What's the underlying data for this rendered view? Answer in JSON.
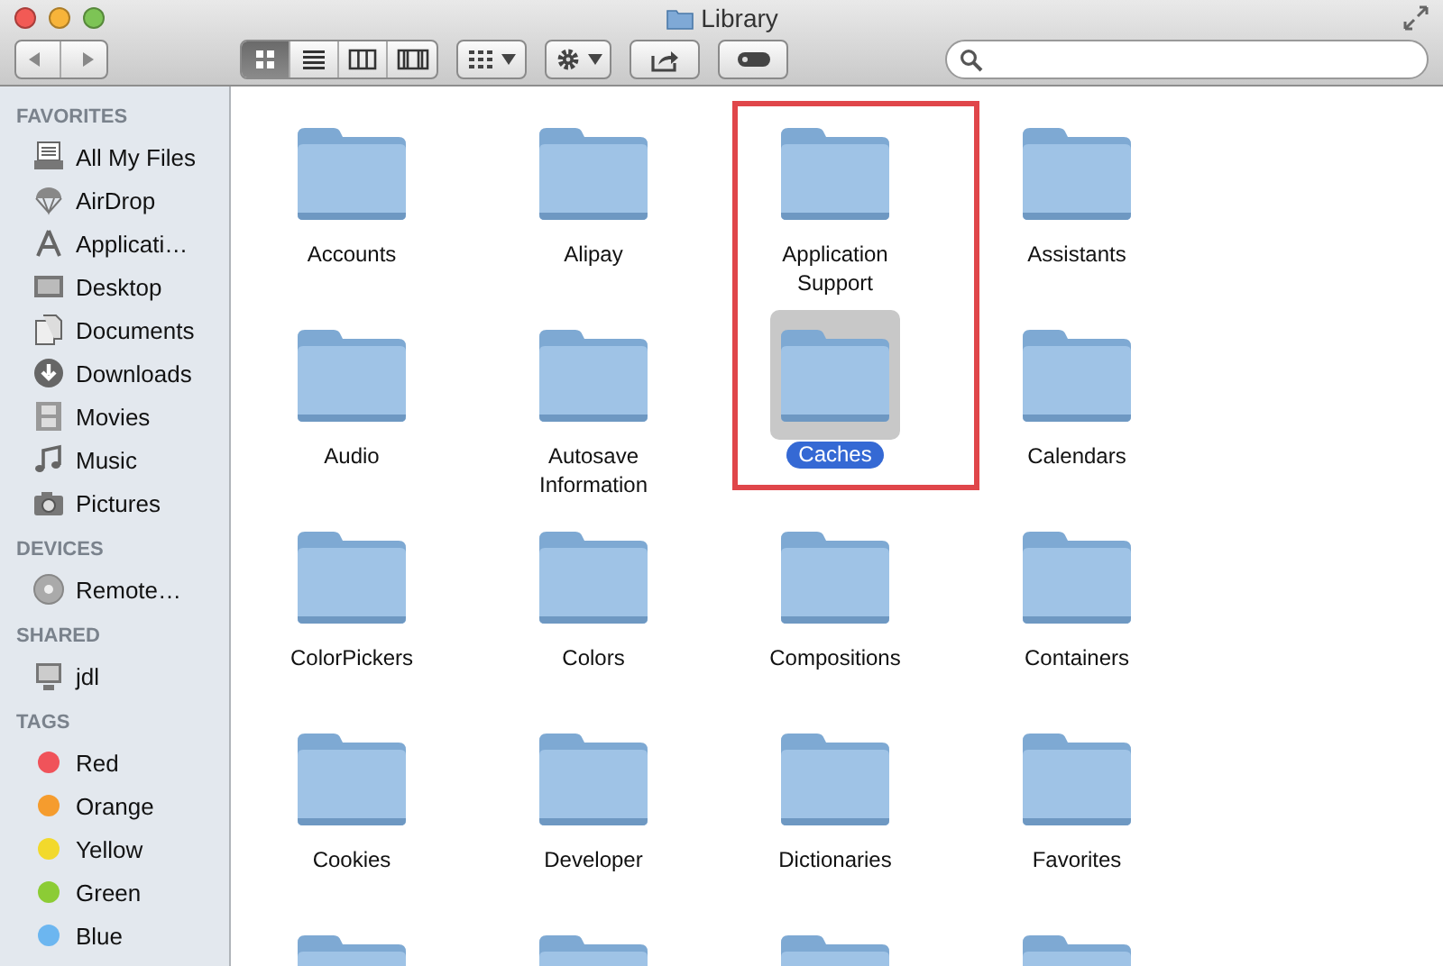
{
  "window": {
    "title": "Library"
  },
  "toolbar": {
    "view_modes": [
      {
        "selected": true
      },
      {
        "selected": false
      },
      {
        "selected": false
      },
      {
        "selected": false
      }
    ]
  },
  "sidebar": {
    "sections": [
      {
        "title": "FAVORITES",
        "items": [
          {
            "label": "All My Files"
          },
          {
            "label": "AirDrop"
          },
          {
            "label": "Applicati…"
          },
          {
            "label": "Desktop"
          },
          {
            "label": "Documents"
          },
          {
            "label": "Downloads"
          },
          {
            "label": "Movies"
          },
          {
            "label": "Music"
          },
          {
            "label": "Pictures"
          }
        ]
      },
      {
        "title": "DEVICES",
        "items": [
          {
            "label": "Remote…"
          }
        ]
      },
      {
        "title": "SHARED",
        "items": [
          {
            "label": "jdl"
          }
        ]
      },
      {
        "title": "TAGS",
        "items": [
          {
            "label": "Red",
            "color": "#f0535a"
          },
          {
            "label": "Orange",
            "color": "#f59c2e"
          },
          {
            "label": "Yellow",
            "color": "#f2d92c"
          },
          {
            "label": "Green",
            "color": "#8ccc35"
          },
          {
            "label": "Blue",
            "color": "#6cb6f0"
          }
        ]
      }
    ]
  },
  "folders": [
    {
      "name": "Accounts",
      "selected": false,
      "highlighted": false
    },
    {
      "name": "Alipay",
      "selected": false,
      "highlighted": false
    },
    {
      "name": "Application Support",
      "selected": false,
      "highlighted": true
    },
    {
      "name": "Assistants",
      "selected": false,
      "highlighted": false
    },
    {
      "name": "Audio",
      "selected": false,
      "highlighted": false
    },
    {
      "name": "Autosave Information",
      "selected": false,
      "highlighted": false
    },
    {
      "name": "Caches",
      "selected": true,
      "highlighted": true
    },
    {
      "name": "Calendars",
      "selected": false,
      "highlighted": false
    },
    {
      "name": "ColorPickers",
      "selected": false,
      "highlighted": false
    },
    {
      "name": "Colors",
      "selected": false,
      "highlighted": false
    },
    {
      "name": "Compositions",
      "selected": false,
      "highlighted": false
    },
    {
      "name": "Containers",
      "selected": false,
      "highlighted": false
    },
    {
      "name": "Cookies",
      "selected": false,
      "highlighted": false
    },
    {
      "name": "Developer",
      "selected": false,
      "highlighted": false
    },
    {
      "name": "Dictionaries",
      "selected": false,
      "highlighted": false
    },
    {
      "name": "Favorites",
      "selected": false,
      "highlighted": false
    },
    {
      "selected": false,
      "highlighted": false
    },
    {
      "selected": false,
      "highlighted": false
    },
    {
      "selected": false,
      "highlighted": false
    },
    {
      "selected": false,
      "highlighted": false
    }
  ]
}
